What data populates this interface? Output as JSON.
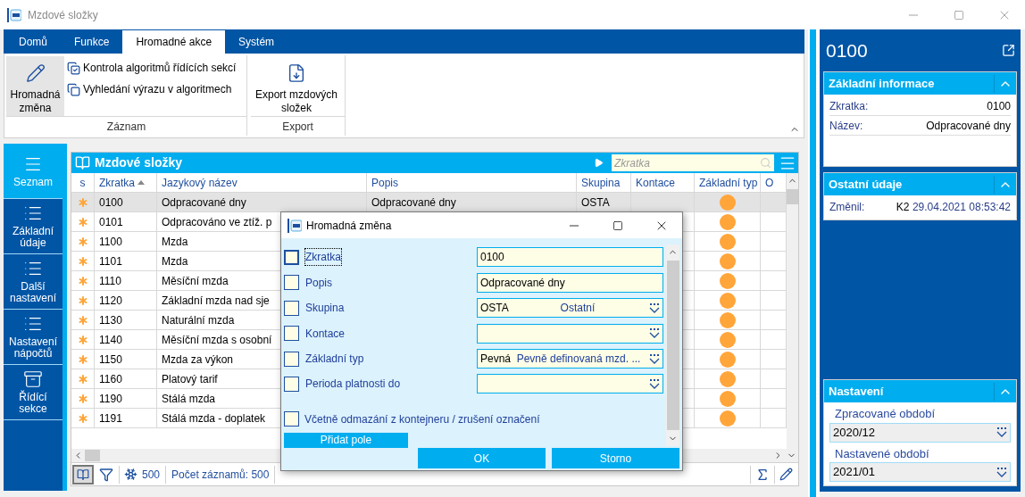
{
  "window": {
    "title": "Mzdové složky"
  },
  "ribbon": {
    "tabs": [
      {
        "label": "Domů",
        "selected": false
      },
      {
        "label": "Funkce",
        "selected": false
      },
      {
        "label": "Hromadné akce",
        "selected": true
      },
      {
        "label": "Systém",
        "selected": false
      }
    ],
    "groups": [
      {
        "label": "Záznam",
        "items": [
          {
            "kind": "large",
            "label": "Hromadná změna",
            "highlighted": true
          },
          {
            "kind": "small",
            "label": "Kontrola algoritmů řídících sekcí"
          },
          {
            "kind": "small",
            "label": "Vyhledání výrazu v algoritmech"
          }
        ]
      },
      {
        "label": "Export",
        "items": [
          {
            "kind": "large",
            "label": "Export mzdových složek",
            "highlighted": false
          }
        ]
      }
    ]
  },
  "nav": [
    {
      "label": "Seznam",
      "selected": true
    },
    {
      "label": "Základní údaje",
      "selected": false
    },
    {
      "label": "Další nastavení",
      "selected": false
    },
    {
      "label": "Nastavení nápočtů",
      "selected": false
    },
    {
      "label": "Řídící sekce",
      "selected": false
    }
  ],
  "table": {
    "title": "Mzdové složky",
    "search": {
      "placeholder": "Zkratka"
    },
    "columns": [
      "s",
      "Zkratka",
      "Jazykový název",
      "Popis",
      "Skupina",
      "Kontace",
      "Základní typ",
      "O"
    ],
    "rows": [
      {
        "zkratka": "0100",
        "nazev": "Odpracované dny",
        "popis": "Odpracované dny",
        "skupina": "OSTA",
        "selected": true,
        "color": "#ffa53a"
      },
      {
        "zkratka": "0101",
        "nazev": "Odpracováno ve ztíž. p",
        "selected": false,
        "color": "#ffa53a"
      },
      {
        "zkratka": "1100",
        "nazev": "Mzda",
        "selected": false,
        "color": "#ffa53a"
      },
      {
        "zkratka": "1101",
        "nazev": "Mzda",
        "selected": false,
        "color": "#ffa53a"
      },
      {
        "zkratka": "1110",
        "nazev": "Měsíční mzda",
        "selected": false,
        "color": "#ffa53a"
      },
      {
        "zkratka": "1120",
        "nazev": "Základní mzda nad sje",
        "selected": false,
        "color": "#ffa53a"
      },
      {
        "zkratka": "1130",
        "nazev": "Naturální mzda",
        "selected": false,
        "color": "#ffa53a"
      },
      {
        "zkratka": "1140",
        "nazev": "Měsíční mzda s osobní",
        "selected": false,
        "color": "#ffa53a"
      },
      {
        "zkratka": "1150",
        "nazev": "Mzda za výkon",
        "selected": false,
        "color": "#ffa53a"
      },
      {
        "zkratka": "1160",
        "nazev": "Platový tarif",
        "selected": false,
        "color": "#ffa53a"
      },
      {
        "zkratka": "1190",
        "nazev": "Stálá mzda",
        "selected": false,
        "color": "#ffa53a"
      },
      {
        "zkratka": "1191",
        "nazev": "Stálá mzda - doplatek",
        "selected": false,
        "color": "#ffa53a"
      }
    ],
    "footer": {
      "count": "500",
      "records": "Počet záznamů: 500"
    }
  },
  "dialog": {
    "title": "Hromadná změna",
    "fields": [
      {
        "label": "Zkratka",
        "checked": false,
        "focused": true,
        "kind": "text",
        "value": "0100"
      },
      {
        "label": "Popis",
        "checked": false,
        "focused": false,
        "kind": "text",
        "value": "Odpracované dny"
      },
      {
        "label": "Skupina",
        "checked": false,
        "focused": false,
        "kind": "lookup",
        "value": "OSTA",
        "description": "Ostatní"
      },
      {
        "label": "Kontace",
        "checked": false,
        "focused": false,
        "kind": "lookup"
      },
      {
        "label": "Základní typ",
        "checked": false,
        "focused": false,
        "kind": "lookup",
        "value": "Pevná",
        "description": "Pevně definovaná mzd. ..."
      },
      {
        "label": "Perioda platnosti do",
        "checked": false,
        "focused": false,
        "kind": "lookup"
      }
    ],
    "option": {
      "label": "Včetně odmazání z kontejneru / zrušení označení",
      "checked": false
    },
    "add_button": "Přidat pole",
    "buttons": [
      "OK",
      "Storno"
    ]
  },
  "detail": {
    "title": "0100",
    "sections": [
      {
        "title": "Základní informace",
        "expanded": true,
        "kind": "fields",
        "rows": [
          {
            "label": "Zkratka:",
            "value": "0100"
          },
          {
            "label": "Název:",
            "value": "Odpracované dny"
          }
        ]
      },
      {
        "title": "Ostatní údaje",
        "expanded": true,
        "kind": "fields",
        "rows": [
          {
            "label": "Změnil:",
            "value": "K2",
            "detail": "29.04.2021 08:53:42"
          }
        ]
      },
      {
        "title": "Nastavení",
        "expanded": true,
        "kind": "periods",
        "rows": [
          {
            "label": "Zpracované období",
            "value": "2020/12"
          },
          {
            "label": "Nastavené období",
            "value": "2021/01"
          }
        ]
      }
    ]
  }
}
